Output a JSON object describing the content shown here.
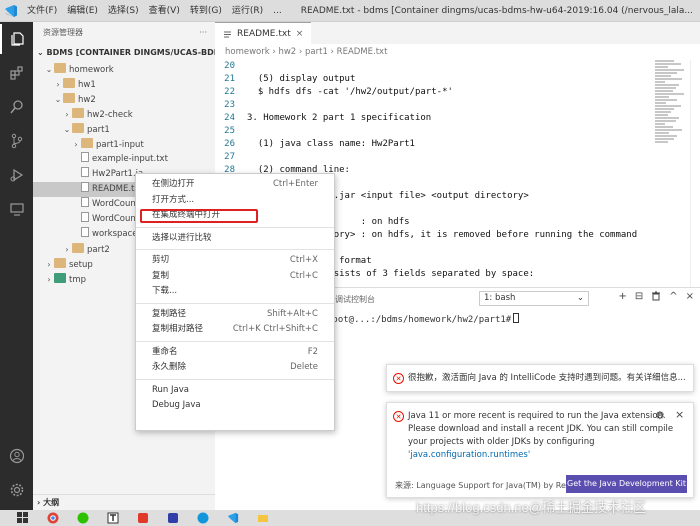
{
  "titlebar": {
    "menus": [
      "文件(F)",
      "编辑(E)",
      "选择(S)",
      "查看(V)",
      "转到(G)",
      "运行(R)",
      "..."
    ],
    "title": "README.txt - bdms [Container dingms/ucas-bdms-hw-u64-2019:16.04 (/nervous_lala..."
  },
  "sidebar": {
    "header": "资源管理器",
    "more": "···",
    "section": "BDMS [CONTAINER DINGMS/UCAS-BDMS-H...",
    "tree": [
      {
        "label": "homework",
        "depth": 1,
        "chev": "⌄",
        "type": "folder"
      },
      {
        "label": "hw1",
        "depth": 2,
        "chev": "›",
        "type": "folder"
      },
      {
        "label": "hw2",
        "depth": 2,
        "chev": "⌄",
        "type": "folder"
      },
      {
        "label": "hw2-check",
        "depth": 3,
        "chev": "›",
        "type": "folder"
      },
      {
        "label": "part1",
        "depth": 3,
        "chev": "⌄",
        "type": "folder"
      },
      {
        "label": "part1-input",
        "depth": 4,
        "chev": "›",
        "type": "folder"
      },
      {
        "label": "example-input.txt",
        "depth": 4,
        "chev": "",
        "type": "file"
      },
      {
        "label": "Hw2Part1.ja",
        "depth": 4,
        "chev": "",
        "type": "file"
      },
      {
        "label": "README.txt",
        "depth": 4,
        "chev": "",
        "type": "file",
        "selected": true
      },
      {
        "label": "WordCount",
        "depth": 4,
        "chev": "",
        "type": "file"
      },
      {
        "label": "WordCount.",
        "depth": 4,
        "chev": "",
        "type": "file"
      },
      {
        "label": "workspace.c",
        "depth": 4,
        "chev": "",
        "type": "file"
      },
      {
        "label": "part2",
        "depth": 3,
        "chev": "›",
        "type": "folder"
      },
      {
        "label": "setup",
        "depth": 1,
        "chev": "›",
        "type": "folder"
      },
      {
        "label": "tmp",
        "depth": 1,
        "chev": "›",
        "type": "folder-green"
      }
    ],
    "outline": "大纲"
  },
  "editor": {
    "tab": "README.txt",
    "tab_close": "×",
    "breadcrumb": "homework › hw2 › part1 › README.txt",
    "lines": [
      {
        "n": "20",
        "t": ""
      },
      {
        "n": "21",
        "t": "  (5) display output"
      },
      {
        "n": "22",
        "t": "  $ hdfs dfs -cat '/hw2/output/part-*'"
      },
      {
        "n": "23",
        "t": ""
      },
      {
        "n": "24",
        "t": "3. Homework 2 part 1 specification"
      },
      {
        "n": "25",
        "t": ""
      },
      {
        "n": "26",
        "t": "  (1) java class name: Hw2Part1"
      },
      {
        "n": "27",
        "t": ""
      },
      {
        "n": "28",
        "t": "  (2) command line:"
      },
      {
        "n": "29",
        "t": ""
      },
      {
        "n": "30",
        "t": "      ./Hw2Part1.jar <input file> <output directory>"
      },
      {
        "n": "31",
        "t": ""
      },
      {
        "n": "32",
        "t": "  <input file>       : on hdfs"
      },
      {
        "n": "33",
        "t": "  <output directory> : on hdfs, it is removed before running the command"
      },
      {
        "n": "34",
        "t": ""
      },
      {
        "n": "35",
        "t": "  (3) input file format"
      },
      {
        "n": "36",
        "t": "  every line consists of 3 fields separated by space:"
      }
    ]
  },
  "panel": {
    "tabs": [
      "问题",
      "输出",
      "调试控制台",
      "终端"
    ],
    "terminal_select": "1: bash",
    "terminal_line": "root@...:/bdms/homework/hw2/part1#",
    "icons": [
      "+",
      "⊟",
      "🗑",
      "^",
      "×"
    ]
  },
  "context_menu": {
    "groups": [
      [
        {
          "label": "在侧边打开",
          "shortcut": "Ctrl+Enter"
        },
        {
          "label": "打开方式...",
          "shortcut": ""
        },
        {
          "label": "在集成终端中打开",
          "shortcut": "",
          "highlighted": true
        }
      ],
      [
        {
          "label": "选择以进行比较",
          "shortcut": ""
        }
      ],
      [
        {
          "label": "剪切",
          "shortcut": "Ctrl+X"
        },
        {
          "label": "复制",
          "shortcut": "Ctrl+C"
        },
        {
          "label": "下载...",
          "shortcut": ""
        }
      ],
      [
        {
          "label": "复制路径",
          "shortcut": "Shift+Alt+C"
        },
        {
          "label": "复制相对路径",
          "shortcut": "Ctrl+K Ctrl+Shift+C"
        }
      ],
      [
        {
          "label": "重命名",
          "shortcut": "F2"
        },
        {
          "label": "永久删除",
          "shortcut": "Delete"
        }
      ],
      [
        {
          "label": "Run Java",
          "shortcut": ""
        },
        {
          "label": "Debug Java",
          "shortcut": ""
        }
      ]
    ]
  },
  "notifications": {
    "n1": {
      "text": "很抱歉，激活面向 Java 的 IntelliCode 支持时遇到问题。有关详细信息..."
    },
    "n2": {
      "line1": "Java 11 or more recent is required to run the Java extension.",
      "line2": "Please download and install a recent JDK. You can still compile",
      "line3": "your projects with older JDKs by configuring",
      "link": "'java.configuration.runtimes'",
      "source": "来源: Language Support for Java(TM) by Red ...",
      "button": "Get the Java Development Kit",
      "gear": "⚙",
      "close": "×"
    }
  },
  "watermark": "https://blog.csdn.ne@稀土掘金技术社区",
  "colors": {
    "activity_bar": "#2c2c2c",
    "sidebar": "#f3f3f3",
    "accent_button": "#5a4fb0",
    "error": "#e51400",
    "highlight_box": "#e02020"
  }
}
